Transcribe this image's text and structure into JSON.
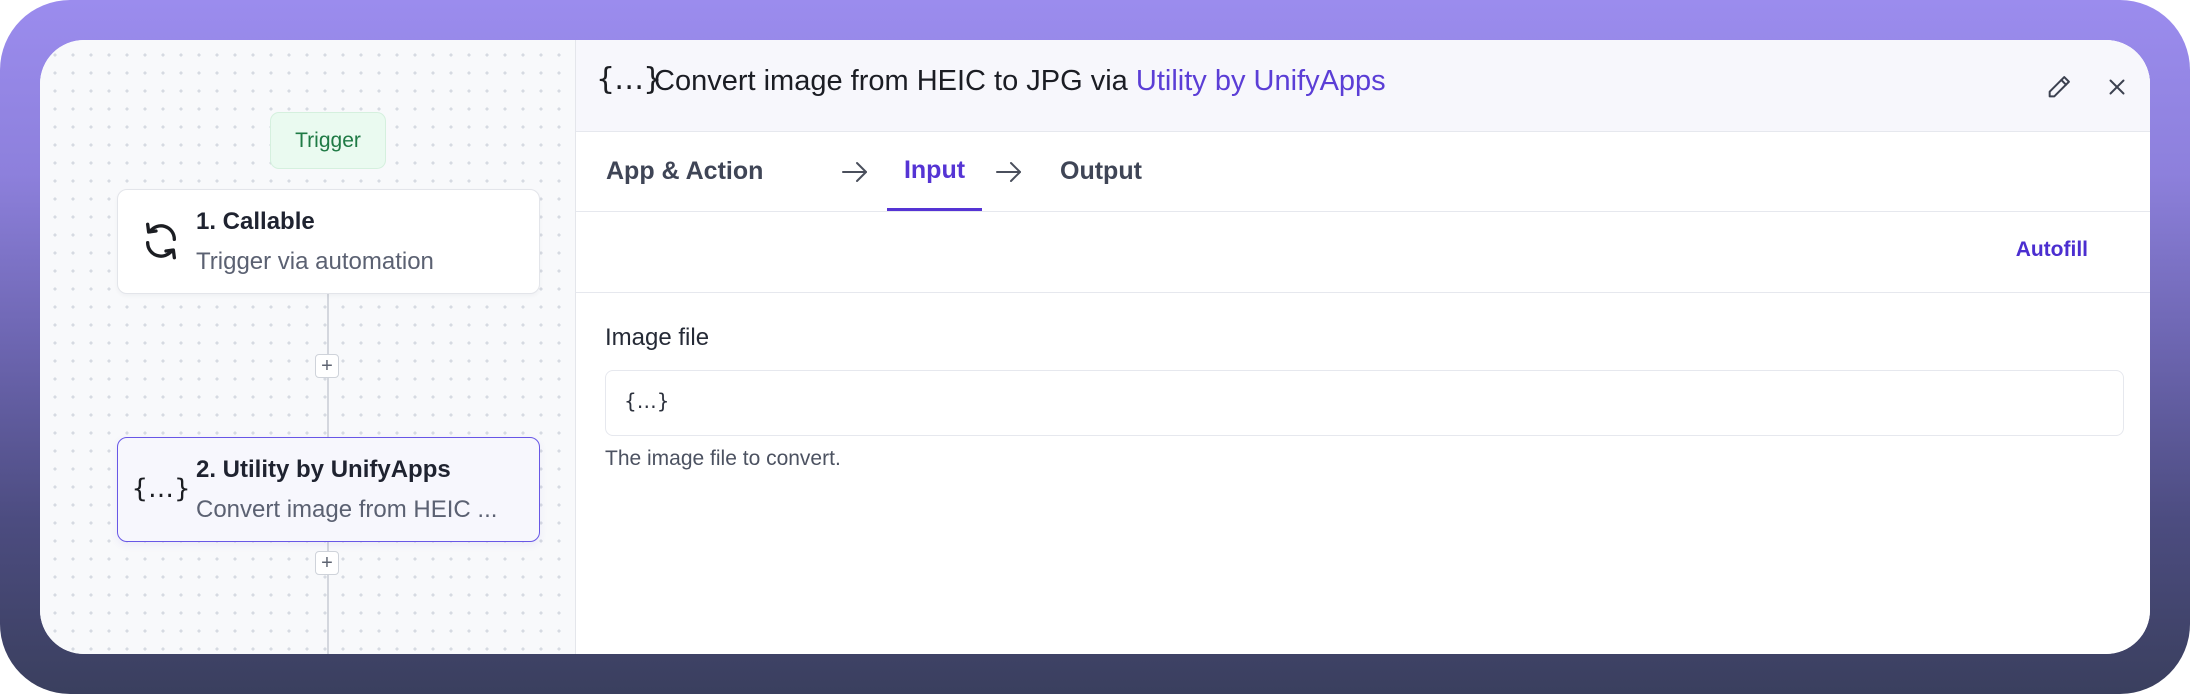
{
  "canvas": {
    "trigger_badge": "Trigger",
    "steps": [
      {
        "title": "1. Callable",
        "subtitle": "Trigger via automation",
        "icon": "sync-icon"
      },
      {
        "title": "2. Utility by UnifyApps",
        "subtitle": "Convert image from HEIC ...",
        "icon": "curly-braces-icon"
      }
    ],
    "add_step_symbol": "+"
  },
  "panel": {
    "header": {
      "icon_text": "{…}",
      "title_prefix": "Convert image from HEIC to JPG via ",
      "title_app": "Utility by UnifyApps",
      "accent_color": "#5b3ed6"
    },
    "tabs": [
      {
        "label": "App & Action",
        "active": false
      },
      {
        "label": "Input",
        "active": true
      },
      {
        "label": "Output",
        "active": false
      }
    ],
    "autofill_label": "Autofill",
    "field": {
      "label": "Image file",
      "value": "{…}",
      "help": "The image file to convert."
    }
  }
}
